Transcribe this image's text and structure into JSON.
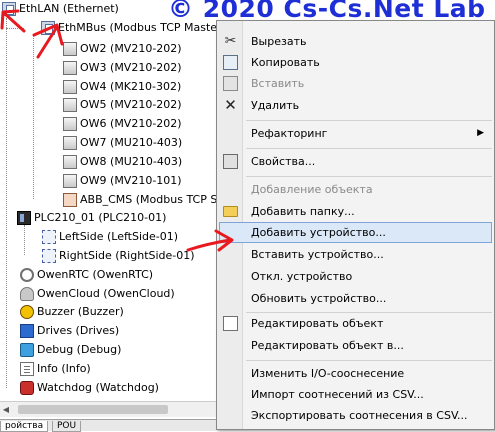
{
  "watermark": "© 2020 Cs-Cs.Net Lab",
  "tree": {
    "ethlan": "EthLAN (Ethernet)",
    "ethmbus": "EthMBus (Modbus TCP Master)",
    "ow2": "OW2 (MV210-202)",
    "ow3": "OW3 (MV210-202)",
    "ow4": "OW4 (MK210-302)",
    "ow5": "OW5 (MV210-202)",
    "ow6": "OW6 (MV210-202)",
    "ow7": "OW7 (MU210-403)",
    "ow8": "OW8 (MU210-403)",
    "ow9": "OW9 (MV210-101)",
    "abb": "ABB_CMS (Modbus TCP Slav",
    "plc": "PLC210_01 (PLC210-01)",
    "leftside": "LeftSide (LeftSide-01)",
    "rightside": "RightSide (RightSide-01)",
    "owenrtc": "OwenRTC (OwenRTC)",
    "owencloud": "OwenCloud (OwenCloud)",
    "buzzer": "Buzzer (Buzzer)",
    "drives": "Drives (Drives)",
    "debug": "Debug (Debug)",
    "info": "Info (Info)",
    "watchdog": "Watchdog (Watchdog)"
  },
  "bottom_tabs": [
    "ройства",
    "POU"
  ],
  "menu": {
    "cut": "Вырезать",
    "copy": "Копировать",
    "paste": "Вставить",
    "delete": "Удалить",
    "refactoring": "Рефакторинг",
    "properties": "Свойства...",
    "add_object": "Добавление объекта",
    "add_folder": "Добавить папку...",
    "add_device": "Добавить устройство...",
    "insert_device": "Вставить устройство...",
    "disable_device": "Откл. устройство",
    "update_device": "Обновить устройство...",
    "edit_object": "Редактировать объект",
    "edit_object_in": "Редактировать объект в...",
    "edit_io_mapping": "Изменить I/O-сооснесение",
    "import_csv": "Импорт соотнесений из CSV...",
    "export_csv": "Экспортировать соотнесения в CSV..."
  },
  "colors": {
    "watermark": "#1f2fd6",
    "highlight": "#dbe8f8",
    "arrow": "#e8191f"
  },
  "icons": {
    "cut": "scissors-icon",
    "copy": "copy-icon",
    "paste": "paste-icon",
    "delete": "delete-x-icon",
    "refactoring": "submenu-arrow-icon",
    "properties": "properties-icon",
    "add_folder": "folder-icon",
    "edit_object": "edit-icon"
  }
}
